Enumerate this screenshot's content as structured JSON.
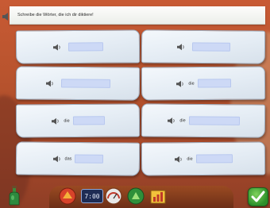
{
  "instruction": {
    "text": "Schreibe die Wörter, die ich dir diktiere!"
  },
  "cards": [
    {
      "article": ""
    },
    {
      "article": ""
    },
    {
      "article": ""
    },
    {
      "article": "die"
    },
    {
      "article": "die"
    },
    {
      "article": "die"
    },
    {
      "article": "das"
    },
    {
      "article": "die"
    }
  ],
  "toolbar": {
    "counter_text": "7:00",
    "icons": [
      "hat-icon",
      "counter-icon",
      "meter-icon",
      "hat-green-icon",
      "bars-icon"
    ]
  },
  "colors": {
    "background": "#b9542e",
    "card": "#e4ecf4",
    "answer_field": "#cdd9f6",
    "check_button": "#2c8f2a"
  }
}
